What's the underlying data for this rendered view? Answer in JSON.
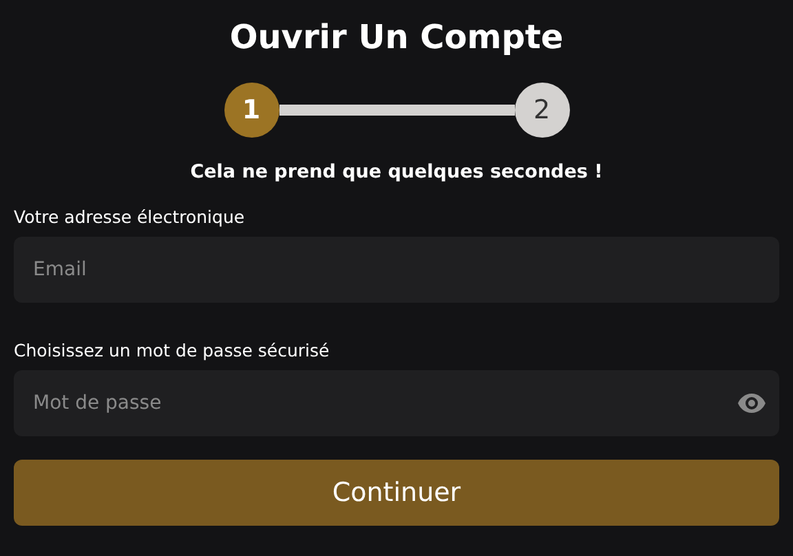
{
  "title": "Ouvrir Un Compte",
  "steps": [
    {
      "label": "1",
      "selected": true
    },
    {
      "label": "2",
      "selected": false
    }
  ],
  "subtitle": "Cela ne prend que quelques secondes !",
  "fields": [
    {
      "kind": "email",
      "label": "Votre adresse électronique",
      "placeholder": "Email"
    },
    {
      "kind": "password",
      "label": "Choisissez un mot de passe sécurisé",
      "placeholder": "Mot de passe"
    }
  ],
  "submit": "Continuer"
}
